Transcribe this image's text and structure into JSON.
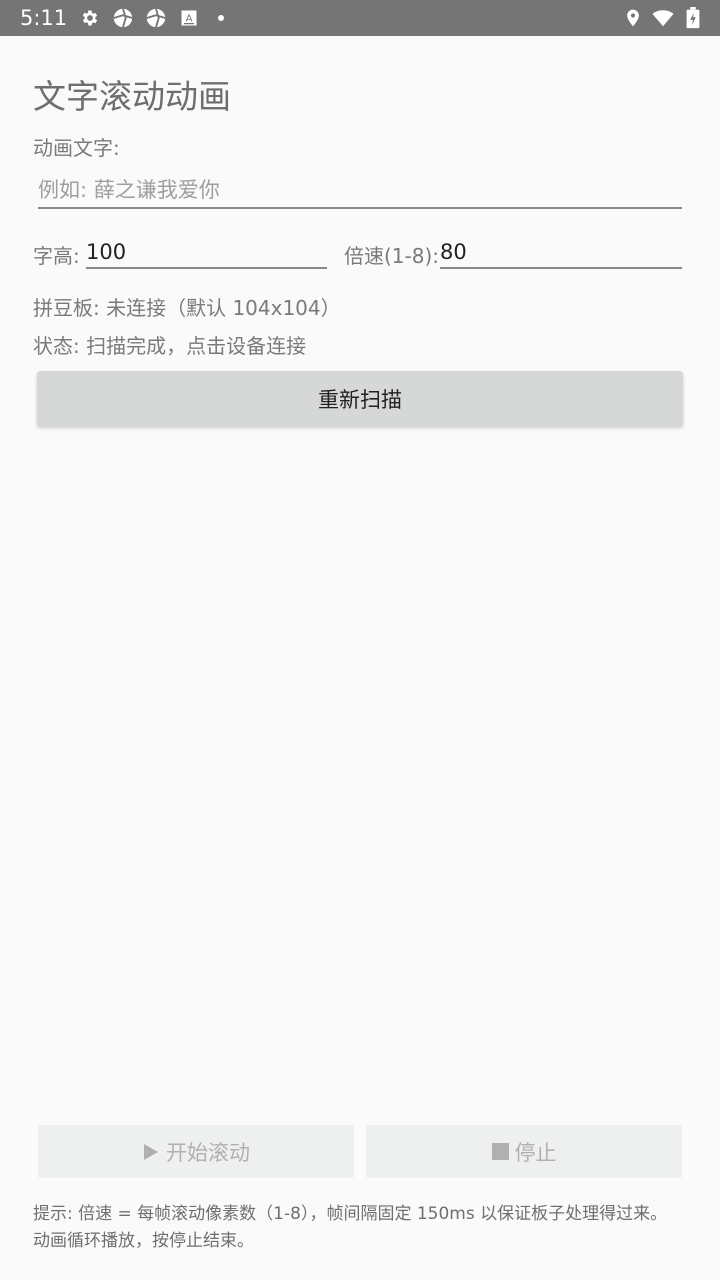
{
  "status_bar": {
    "time": "5:11",
    "icons": [
      "settings-icon",
      "aperture-icon",
      "aperture-icon-2",
      "keyboard-a-icon",
      "dot-icon",
      "location-icon",
      "wifi-icon",
      "battery-charging-icon"
    ]
  },
  "page": {
    "title": "文字滚动动画",
    "text_label": "动画文字:",
    "text_placeholder": "例如: 薛之谦我爱你",
    "text_value": "",
    "height_label": "字高:",
    "height_value": "100",
    "speed_label": "倍速(1-8):",
    "speed_value": "80",
    "board_status": "拼豆板: 未连接（默认 104x104）",
    "scan_status": "状态: 扫描完成，点击设备连接",
    "rescan_label": "重新扫描"
  },
  "controls": {
    "start_label": "开始滚动",
    "stop_label": "停止"
  },
  "hint": {
    "line1": "提示: 倍速 = 每帧滚动像素数（1-8），帧间隔固定 150ms 以保证板子处理得过来。",
    "line2": "动画循环播放，按停止结束。"
  },
  "colors": {
    "status_bar": "#757575",
    "background": "#fafafa",
    "button": "#d6d7d7",
    "disabled_button": "#eef0f0"
  }
}
